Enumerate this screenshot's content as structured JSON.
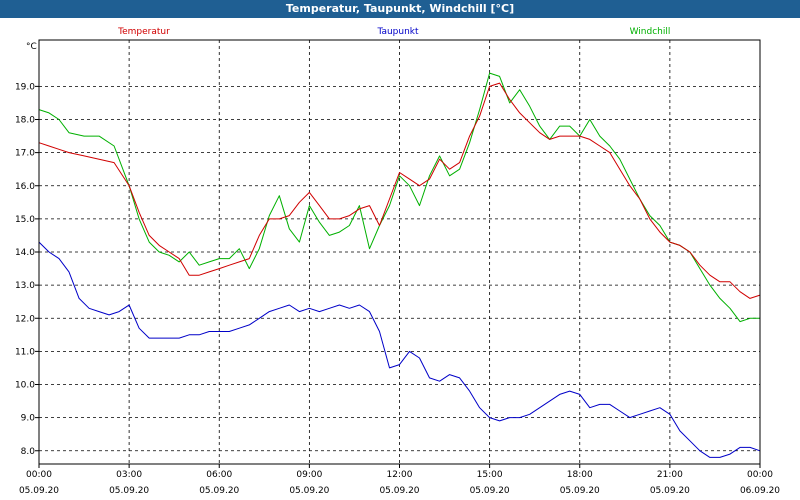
{
  "window": {
    "title": "Temperatur, Taupunkt, Windchill [°C]"
  },
  "colors": {
    "background": "#ffffff",
    "title_bar": "#1f5f93",
    "grid": "#000000",
    "temperatur": "#d00000",
    "taupunkt": "#0000c8",
    "windchill": "#00b000"
  },
  "chart_data": {
    "type": "line",
    "title": "Temperatur, Taupunkt, Windchill [°C]",
    "unit_label": "°C",
    "ylim": [
      7.6,
      20.4
    ],
    "y_ticks": [
      {
        "value": 8.0,
        "label": "8.0"
      },
      {
        "value": 9.0,
        "label": "9.0"
      },
      {
        "value": 10.0,
        "label": "10.0"
      },
      {
        "value": 11.0,
        "label": "11.0"
      },
      {
        "value": 12.0,
        "label": "12.0"
      },
      {
        "value": 13.0,
        "label": "13.0"
      },
      {
        "value": 14.0,
        "label": "14.0"
      },
      {
        "value": 15.0,
        "label": "15.0"
      },
      {
        "value": 16.0,
        "label": "16.0"
      },
      {
        "value": 17.0,
        "label": "17.0"
      },
      {
        "value": 18.0,
        "label": "18.0"
      },
      {
        "value": 19.0,
        "label": "19.0"
      }
    ],
    "xlim": [
      "05.09.20 00:00",
      "06.09.20 00:00"
    ],
    "x_ticks": [
      {
        "time": "00:00",
        "date": "05.09.20"
      },
      {
        "time": "03:00",
        "date": "05.09.20"
      },
      {
        "time": "06:00",
        "date": "05.09.20"
      },
      {
        "time": "09:00",
        "date": "05.09.20"
      },
      {
        "time": "12:00",
        "date": "05.09.20"
      },
      {
        "time": "15:00",
        "date": "05.09.20"
      },
      {
        "time": "18:00",
        "date": "05.09.20"
      },
      {
        "time": "21:00",
        "date": "05.09.20"
      },
      {
        "time": "00:00",
        "date": "06.09.20"
      }
    ],
    "grid": true,
    "legend_placement": "top",
    "series": [
      {
        "name": "Temperatur",
        "color": "#d00000",
        "points": [
          [
            "00:00",
            17.3
          ],
          [
            "00:20",
            17.2
          ],
          [
            "00:40",
            17.1
          ],
          [
            "01:00",
            17.0
          ],
          [
            "01:30",
            16.9
          ],
          [
            "02:00",
            16.8
          ],
          [
            "02:30",
            16.7
          ],
          [
            "03:00",
            16.0
          ],
          [
            "03:20",
            15.2
          ],
          [
            "03:40",
            14.5
          ],
          [
            "04:00",
            14.2
          ],
          [
            "04:20",
            14.0
          ],
          [
            "04:40",
            13.8
          ],
          [
            "05:00",
            13.3
          ],
          [
            "05:20",
            13.3
          ],
          [
            "05:40",
            13.4
          ],
          [
            "06:00",
            13.5
          ],
          [
            "06:20",
            13.6
          ],
          [
            "06:40",
            13.7
          ],
          [
            "07:00",
            13.8
          ],
          [
            "07:20",
            14.5
          ],
          [
            "07:40",
            15.0
          ],
          [
            "08:00",
            15.0
          ],
          [
            "08:20",
            15.1
          ],
          [
            "08:40",
            15.5
          ],
          [
            "09:00",
            15.8
          ],
          [
            "09:20",
            15.4
          ],
          [
            "09:40",
            15.0
          ],
          [
            "10:00",
            15.0
          ],
          [
            "10:20",
            15.1
          ],
          [
            "10:40",
            15.3
          ],
          [
            "11:00",
            15.4
          ],
          [
            "11:20",
            14.8
          ],
          [
            "11:40",
            15.6
          ],
          [
            "12:00",
            16.4
          ],
          [
            "12:20",
            16.2
          ],
          [
            "12:40",
            16.0
          ],
          [
            "13:00",
            16.2
          ],
          [
            "13:20",
            16.8
          ],
          [
            "13:40",
            16.5
          ],
          [
            "14:00",
            16.7
          ],
          [
            "14:20",
            17.5
          ],
          [
            "14:40",
            18.1
          ],
          [
            "15:00",
            19.0
          ],
          [
            "15:20",
            19.1
          ],
          [
            "15:40",
            18.6
          ],
          [
            "16:00",
            18.2
          ],
          [
            "16:20",
            17.9
          ],
          [
            "16:40",
            17.6
          ],
          [
            "17:00",
            17.4
          ],
          [
            "17:20",
            17.5
          ],
          [
            "17:40",
            17.5
          ],
          [
            "18:00",
            17.5
          ],
          [
            "18:20",
            17.4
          ],
          [
            "18:40",
            17.2
          ],
          [
            "19:00",
            17.0
          ],
          [
            "19:20",
            16.5
          ],
          [
            "19:40",
            16.0
          ],
          [
            "20:00",
            15.6
          ],
          [
            "20:20",
            15.0
          ],
          [
            "20:40",
            14.6
          ],
          [
            "21:00",
            14.3
          ],
          [
            "21:20",
            14.2
          ],
          [
            "21:40",
            14.0
          ],
          [
            "22:00",
            13.6
          ],
          [
            "22:20",
            13.3
          ],
          [
            "22:40",
            13.1
          ],
          [
            "23:00",
            13.1
          ],
          [
            "23:20",
            12.8
          ],
          [
            "23:40",
            12.6
          ],
          [
            "24:00",
            12.7
          ]
        ]
      },
      {
        "name": "Taupunkt",
        "color": "#0000c8",
        "points": [
          [
            "00:00",
            14.3
          ],
          [
            "00:20",
            14.0
          ],
          [
            "00:40",
            13.8
          ],
          [
            "01:00",
            13.4
          ],
          [
            "01:20",
            12.6
          ],
          [
            "01:40",
            12.3
          ],
          [
            "02:00",
            12.2
          ],
          [
            "02:20",
            12.1
          ],
          [
            "02:40",
            12.2
          ],
          [
            "03:00",
            12.4
          ],
          [
            "03:20",
            11.7
          ],
          [
            "03:40",
            11.4
          ],
          [
            "04:00",
            11.4
          ],
          [
            "04:20",
            11.4
          ],
          [
            "04:40",
            11.4
          ],
          [
            "05:00",
            11.5
          ],
          [
            "05:20",
            11.5
          ],
          [
            "05:40",
            11.6
          ],
          [
            "06:00",
            11.6
          ],
          [
            "06:20",
            11.6
          ],
          [
            "06:40",
            11.7
          ],
          [
            "07:00",
            11.8
          ],
          [
            "07:20",
            12.0
          ],
          [
            "07:40",
            12.2
          ],
          [
            "08:00",
            12.3
          ],
          [
            "08:20",
            12.4
          ],
          [
            "08:40",
            12.2
          ],
          [
            "09:00",
            12.3
          ],
          [
            "09:20",
            12.2
          ],
          [
            "09:40",
            12.3
          ],
          [
            "10:00",
            12.4
          ],
          [
            "10:20",
            12.3
          ],
          [
            "10:40",
            12.4
          ],
          [
            "11:00",
            12.2
          ],
          [
            "11:20",
            11.6
          ],
          [
            "11:40",
            10.5
          ],
          [
            "12:00",
            10.6
          ],
          [
            "12:20",
            11.0
          ],
          [
            "12:40",
            10.8
          ],
          [
            "13:00",
            10.2
          ],
          [
            "13:20",
            10.1
          ],
          [
            "13:40",
            10.3
          ],
          [
            "14:00",
            10.2
          ],
          [
            "14:20",
            9.8
          ],
          [
            "14:40",
            9.3
          ],
          [
            "15:00",
            9.0
          ],
          [
            "15:20",
            8.9
          ],
          [
            "15:40",
            9.0
          ],
          [
            "16:00",
            9.0
          ],
          [
            "16:20",
            9.1
          ],
          [
            "16:40",
            9.3
          ],
          [
            "17:00",
            9.5
          ],
          [
            "17:20",
            9.7
          ],
          [
            "17:40",
            9.8
          ],
          [
            "18:00",
            9.7
          ],
          [
            "18:20",
            9.3
          ],
          [
            "18:40",
            9.4
          ],
          [
            "19:00",
            9.4
          ],
          [
            "19:20",
            9.2
          ],
          [
            "19:40",
            9.0
          ],
          [
            "20:00",
            9.1
          ],
          [
            "20:20",
            9.2
          ],
          [
            "20:40",
            9.3
          ],
          [
            "21:00",
            9.1
          ],
          [
            "21:20",
            8.6
          ],
          [
            "21:40",
            8.3
          ],
          [
            "22:00",
            8.0
          ],
          [
            "22:20",
            7.8
          ],
          [
            "22:40",
            7.8
          ],
          [
            "23:00",
            7.9
          ],
          [
            "23:20",
            8.1
          ],
          [
            "23:40",
            8.1
          ],
          [
            "24:00",
            8.0
          ]
        ]
      },
      {
        "name": "Windchill",
        "color": "#00b000",
        "points": [
          [
            "00:00",
            18.3
          ],
          [
            "00:20",
            18.2
          ],
          [
            "00:40",
            18.0
          ],
          [
            "01:00",
            17.6
          ],
          [
            "01:30",
            17.5
          ],
          [
            "02:00",
            17.5
          ],
          [
            "02:30",
            17.2
          ],
          [
            "03:00",
            16.0
          ],
          [
            "03:20",
            15.0
          ],
          [
            "03:40",
            14.3
          ],
          [
            "04:00",
            14.0
          ],
          [
            "04:20",
            13.9
          ],
          [
            "04:40",
            13.7
          ],
          [
            "05:00",
            14.0
          ],
          [
            "05:20",
            13.6
          ],
          [
            "05:40",
            13.7
          ],
          [
            "06:00",
            13.8
          ],
          [
            "06:20",
            13.8
          ],
          [
            "06:40",
            14.1
          ],
          [
            "07:00",
            13.5
          ],
          [
            "07:20",
            14.1
          ],
          [
            "07:40",
            15.1
          ],
          [
            "08:00",
            15.7
          ],
          [
            "08:20",
            14.7
          ],
          [
            "08:40",
            14.3
          ],
          [
            "09:00",
            15.4
          ],
          [
            "09:20",
            14.9
          ],
          [
            "09:40",
            14.5
          ],
          [
            "10:00",
            14.6
          ],
          [
            "10:20",
            14.8
          ],
          [
            "10:40",
            15.4
          ],
          [
            "11:00",
            14.1
          ],
          [
            "11:20",
            14.8
          ],
          [
            "11:40",
            15.4
          ],
          [
            "12:00",
            16.3
          ],
          [
            "12:20",
            16.0
          ],
          [
            "12:40",
            15.4
          ],
          [
            "13:00",
            16.3
          ],
          [
            "13:20",
            16.9
          ],
          [
            "13:40",
            16.3
          ],
          [
            "14:00",
            16.5
          ],
          [
            "14:20",
            17.3
          ],
          [
            "14:40",
            18.3
          ],
          [
            "15:00",
            19.4
          ],
          [
            "15:20",
            19.3
          ],
          [
            "15:40",
            18.5
          ],
          [
            "16:00",
            18.9
          ],
          [
            "16:20",
            18.4
          ],
          [
            "16:40",
            17.8
          ],
          [
            "17:00",
            17.4
          ],
          [
            "17:20",
            17.8
          ],
          [
            "17:40",
            17.8
          ],
          [
            "18:00",
            17.5
          ],
          [
            "18:20",
            18.0
          ],
          [
            "18:40",
            17.5
          ],
          [
            "19:00",
            17.2
          ],
          [
            "19:20",
            16.8
          ],
          [
            "19:40",
            16.2
          ],
          [
            "20:00",
            15.6
          ],
          [
            "20:20",
            15.1
          ],
          [
            "20:40",
            14.8
          ],
          [
            "21:00",
            14.3
          ],
          [
            "21:20",
            14.2
          ],
          [
            "21:40",
            14.0
          ],
          [
            "22:00",
            13.5
          ],
          [
            "22:20",
            13.0
          ],
          [
            "22:40",
            12.6
          ],
          [
            "23:00",
            12.3
          ],
          [
            "23:20",
            11.9
          ],
          [
            "23:40",
            12.0
          ],
          [
            "24:00",
            12.0
          ]
        ]
      }
    ]
  }
}
